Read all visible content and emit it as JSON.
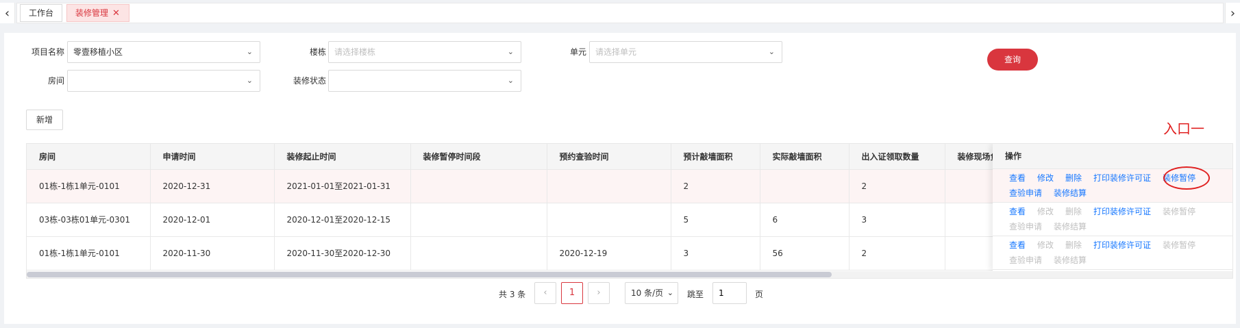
{
  "tabs": {
    "prev_icon": "chevron-left-icon",
    "next_icon": "chevron-right-icon",
    "items": [
      {
        "label": "工作台"
      },
      {
        "label": "装修管理",
        "close": "✕"
      }
    ]
  },
  "filters": {
    "project": {
      "label": "项目名称",
      "value": "零壹移植小区"
    },
    "building": {
      "label": "楼栋",
      "placeholder": "请选择楼栋"
    },
    "unit": {
      "label": "单元",
      "placeholder": "请选择单元"
    },
    "room": {
      "label": "房间",
      "value": ""
    },
    "status": {
      "label": "装修状态",
      "value": ""
    },
    "query_label": "查询"
  },
  "add_label": "新增",
  "annotation": {
    "text": "入口一",
    "color": "#e02020"
  },
  "table": {
    "headers": [
      "房间",
      "申请时间",
      "装修起止时间",
      "装修暂停时间段",
      "预约查验时间",
      "预计敲墙面积",
      "实际敲墙面积",
      "出入证领取数量",
      "装修现场负责人"
    ],
    "ops_header": "操作",
    "rows": [
      {
        "cells": [
          "01栋-1栋1单元-0101",
          "2020-12-31",
          "2021-01-01至2021-01-31",
          "",
          "",
          "2",
          "",
          "2",
          ""
        ]
      },
      {
        "cells": [
          "03栋-03栋01单元-0301",
          "2020-12-01",
          "2020-12-01至2020-12-15",
          "",
          "",
          "5",
          "6",
          "3",
          ""
        ]
      },
      {
        "cells": [
          "01栋-1栋1单元-0101",
          "2020-11-30",
          "2020-11-30至2020-12-30",
          "",
          "2020-12-19",
          "3",
          "56",
          "2",
          ""
        ]
      }
    ],
    "ops": [
      {
        "view": "查看",
        "edit": "修改",
        "delete": "删除",
        "print": "打印装修许可证",
        "pause": "装修暂停",
        "inspect": "查验申请",
        "settle": "装修结算"
      },
      {
        "view": "查看",
        "edit": "修改",
        "delete": "删除",
        "print": "打印装修许可证",
        "pause": "装修暂停",
        "inspect": "查验申请",
        "settle": "装修结算"
      },
      {
        "view": "查看",
        "edit": "修改",
        "delete": "删除",
        "print": "打印装修许可证",
        "pause": "装修暂停",
        "inspect": "查验申请",
        "settle": "装修结算"
      }
    ]
  },
  "pagination": {
    "total": "共 3 条",
    "prev": "‹",
    "current": "1",
    "next": "›",
    "page_size": "10 条/页",
    "jump_label": "跳至",
    "jump_value": "1",
    "unit": "页"
  },
  "colors": {
    "accent": "#d9363e",
    "link": "#1677ff",
    "disabled": "#bfbfbf"
  }
}
